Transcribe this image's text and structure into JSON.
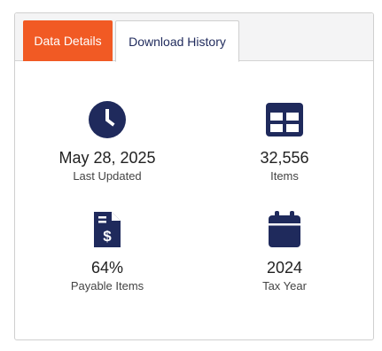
{
  "tabs": {
    "active_label": "Data Details",
    "inactive_label": "Download History"
  },
  "stats": {
    "last_updated": {
      "value": "May 28, 2025",
      "label": "Last Updated",
      "icon": "clock-icon"
    },
    "items": {
      "value": "32,556",
      "label": "Items",
      "icon": "table-icon"
    },
    "payable_items": {
      "value": "64%",
      "label": "Payable Items",
      "icon": "invoice-dollar-icon"
    },
    "tax_year": {
      "value": "2024",
      "label": "Tax Year",
      "icon": "calendar-icon"
    }
  },
  "colors": {
    "accent": "#f15a24",
    "icon": "#1f2a5c",
    "tab_bar_bg": "#f4f4f5"
  }
}
